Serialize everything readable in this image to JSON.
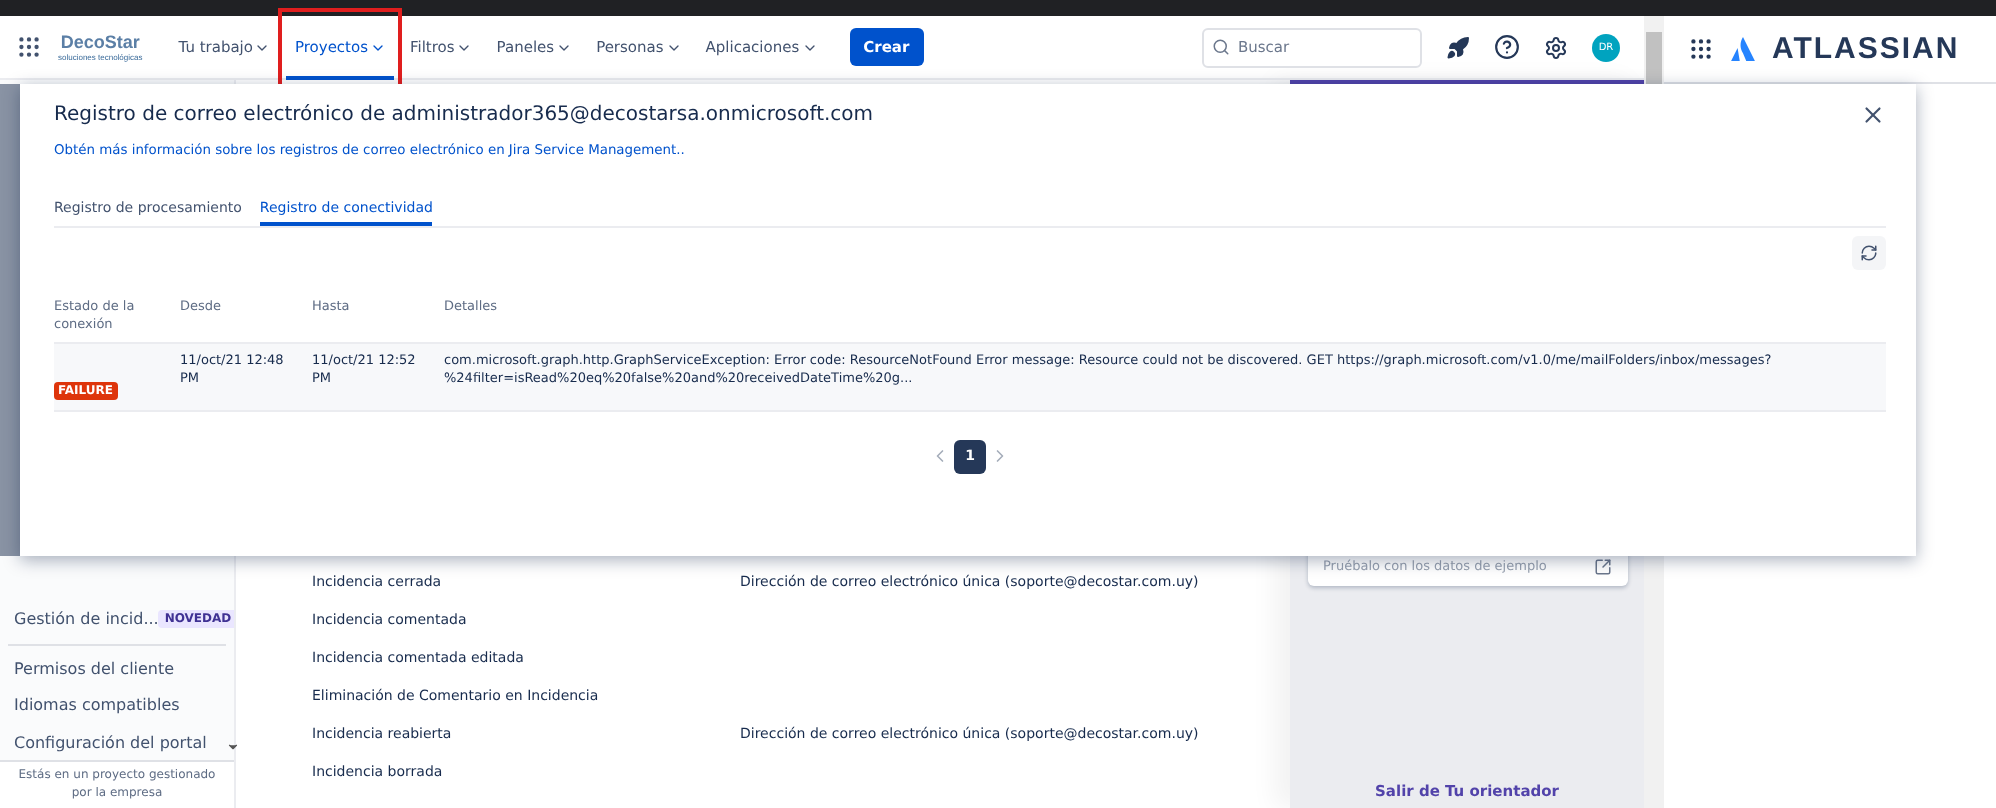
{
  "nav": {
    "logo": {
      "name": "DecoStar",
      "tagline": "soluciones tecnológicas"
    },
    "items": [
      {
        "label": "Tu trabajo",
        "selected": false,
        "highlighted": false
      },
      {
        "label": "Proyectos",
        "selected": true,
        "highlighted": true
      },
      {
        "label": "Filtros",
        "selected": false,
        "highlighted": false
      },
      {
        "label": "Paneles",
        "selected": false,
        "highlighted": false
      },
      {
        "label": "Personas",
        "selected": false,
        "highlighted": false
      },
      {
        "label": "Aplicaciones",
        "selected": false,
        "highlighted": false
      }
    ],
    "create_button": "Crear",
    "search": {
      "placeholder": "Buscar"
    },
    "avatar": "DR"
  },
  "side_panel": {
    "brand": "ATLASSIAN"
  },
  "modal": {
    "title": "Registro de correo electrónico de administrador365@decostarsa.onmicrosoft.com",
    "help_link": "Obtén más información sobre los registros de correo electrónico en Jira Service Management..",
    "tabs": [
      {
        "label": "Registro de procesamiento",
        "selected": false
      },
      {
        "label": "Registro de conectividad",
        "selected": true
      }
    ],
    "table": {
      "columns": [
        "Estado de la conexión",
        "Desde",
        "Hasta",
        "Detalles"
      ],
      "rows": [
        {
          "status": "FAILURE",
          "from": "11/oct/21 12:48 PM",
          "to": "11/oct/21 12:52 PM",
          "details": "com.microsoft.graph.http.GraphServiceException: Error code: ResourceNotFound Error message: Resource could not be discovered. GET https://graph.microsoft.com/v1.0/me/mailFolders/inbox/messages?%24filter=isRead%20eq%20false%20and%20receivedDateTime%20g..."
        }
      ]
    },
    "pagination": {
      "pages": [
        {
          "label": "1",
          "selected": true
        }
      ]
    }
  },
  "sidebar": {
    "items": [
      {
        "label": "Gestión de incid...",
        "badge": "NOVEDAD"
      },
      {
        "label": "Permisos del cliente"
      },
      {
        "label": "Idiomas compatibles"
      },
      {
        "label": "Configuración del portal"
      }
    ],
    "footer": "Estás en un proyecto gestionado por la empresa"
  },
  "events": [
    {
      "event": "Incidencia cerrada",
      "recipient": "Dirección de correo electrónico única (soporte@decostar.com.uy)"
    },
    {
      "event": "Incidencia comentada"
    },
    {
      "event": "Incidencia comentada editada"
    },
    {
      "event": "Eliminación de Comentario en Incidencia"
    },
    {
      "event": "Incidencia reabierta",
      "recipient": "Dirección de correo electrónico única (soporte@decostar.com.uy)"
    },
    {
      "event": "Incidencia borrada"
    }
  ],
  "guide_panel": {
    "card_hint": "Pruébalo con los datos de ejemplo",
    "exit_link": "Salir de Tu orientador"
  }
}
